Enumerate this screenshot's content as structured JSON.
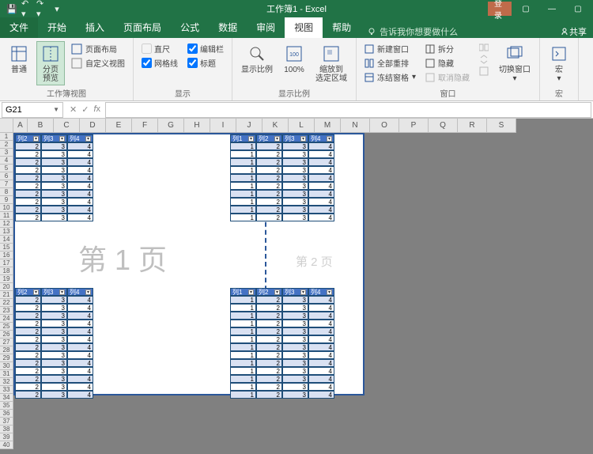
{
  "titlebar": {
    "title": "工作簿1 - Excel",
    "login": "登录"
  },
  "tabs": {
    "file": "文件",
    "home": "开始",
    "insert": "插入",
    "layout": "页面布局",
    "formula": "公式",
    "data": "数据",
    "review": "审阅",
    "view": "视图",
    "help": "帮助",
    "tellme": "告诉我你想要做什么",
    "share": "共享"
  },
  "ribbon": {
    "view": {
      "normal": "普通",
      "pagebreak": "分页\n预览",
      "pagelayout": "页面布局",
      "custom": "自定义视图",
      "group_label": "工作簿视图"
    },
    "show": {
      "ruler": "直尺",
      "formula_bar": "编辑栏",
      "gridlines": "网格线",
      "headings": "标题",
      "group_label": "显示"
    },
    "zoom": {
      "zoom": "显示比例",
      "hundred": "100%",
      "to_selection": "缩放到\n选定区域",
      "group_label": "显示比例"
    },
    "window": {
      "new_window": "新建窗口",
      "arrange": "全部重排",
      "freeze": "冻结窗格",
      "split": "拆分",
      "hide": "隐藏",
      "unhide": "取消隐藏",
      "switch": "切换窗口",
      "group_label": "窗口"
    },
    "macros": {
      "macros": "宏",
      "group_label": "宏"
    }
  },
  "namebox": "G21",
  "columns": [
    "A",
    "B",
    "C",
    "D",
    "E",
    "F",
    "G",
    "H",
    "I",
    "J",
    "K",
    "L",
    "M",
    "N",
    "O",
    "P",
    "Q",
    "R",
    "S"
  ],
  "sheet": {
    "page1_label": "第 1 页",
    "page2_label": "第 2 页",
    "headers": [
      "列1",
      "列2",
      "列3",
      "列4"
    ],
    "left_headers": [
      "列2",
      "列3",
      "列4"
    ],
    "data_row": [
      1,
      2,
      3,
      4
    ],
    "left_data_row": [
      2,
      3,
      4
    ]
  }
}
